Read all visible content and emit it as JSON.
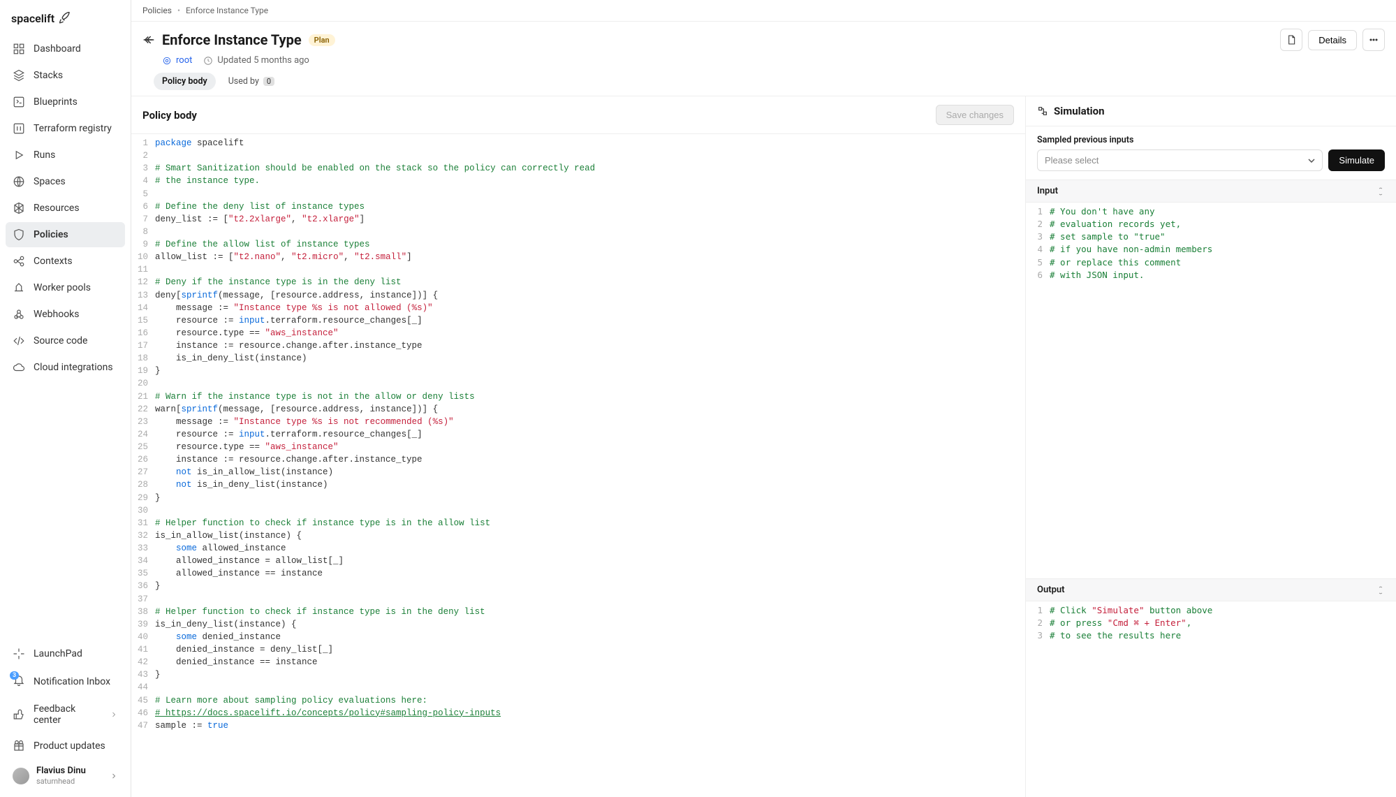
{
  "logo": "spacelift",
  "sidebar": {
    "items": [
      {
        "label": "Dashboard"
      },
      {
        "label": "Stacks"
      },
      {
        "label": "Blueprints"
      },
      {
        "label": "Terraform registry"
      },
      {
        "label": "Runs"
      },
      {
        "label": "Spaces"
      },
      {
        "label": "Resources"
      },
      {
        "label": "Policies"
      },
      {
        "label": "Contexts"
      },
      {
        "label": "Worker pools"
      },
      {
        "label": "Webhooks"
      },
      {
        "label": "Source code"
      },
      {
        "label": "Cloud integrations"
      }
    ],
    "bottom": [
      {
        "label": "LaunchPad"
      },
      {
        "label": "Notification Inbox",
        "badge": "3"
      },
      {
        "label": "Feedback center"
      },
      {
        "label": "Product updates"
      }
    ],
    "user": {
      "name": "Flavius Dinu",
      "org": "saturnhead"
    }
  },
  "breadcrumb": {
    "root": "Policies",
    "current": "Enforce Instance Type"
  },
  "header": {
    "title": "Enforce Instance Type",
    "badge": "Plan",
    "root_label": "root",
    "updated": "Updated 5 months ago",
    "details_label": "Details",
    "save_label": "Save changes"
  },
  "tabs": {
    "body": "Policy body",
    "usedby": "Used by",
    "usedby_count": "0"
  },
  "pane": {
    "body_title": "Policy body",
    "sim_title": "Simulation",
    "sampled_label": "Sampled previous inputs",
    "select_placeholder": "Please select",
    "simulate_label": "Simulate",
    "input_label": "Input",
    "output_label": "Output"
  },
  "code_lines": [
    [
      [
        "kw",
        "package"
      ],
      [
        "id",
        " spacelift"
      ]
    ],
    [],
    [
      [
        "cm",
        "# Smart Sanitization should be enabled on the stack so the policy can correctly read"
      ]
    ],
    [
      [
        "cm",
        "# the instance type."
      ]
    ],
    [],
    [
      [
        "cm",
        "# Define the deny list of instance types"
      ]
    ],
    [
      [
        "id",
        "deny_list := ["
      ],
      [
        "str",
        "\"t2.2xlarge\""
      ],
      [
        "id",
        ", "
      ],
      [
        "str",
        "\"t2.xlarge\""
      ],
      [
        "id",
        "]"
      ]
    ],
    [],
    [
      [
        "cm",
        "# Define the allow list of instance types"
      ]
    ],
    [
      [
        "id",
        "allow_list := ["
      ],
      [
        "str",
        "\"t2.nano\""
      ],
      [
        "id",
        ", "
      ],
      [
        "str",
        "\"t2.micro\""
      ],
      [
        "id",
        ", "
      ],
      [
        "str",
        "\"t2.small\""
      ],
      [
        "id",
        "]"
      ]
    ],
    [],
    [
      [
        "cm",
        "# Deny if the instance type is in the deny list"
      ]
    ],
    [
      [
        "id",
        "deny["
      ],
      [
        "kw",
        "sprintf"
      ],
      [
        "id",
        "(message, [resource.address, instance])] {"
      ]
    ],
    [
      [
        "id",
        "    message := "
      ],
      [
        "str",
        "\"Instance type %s is not allowed (%s)\""
      ]
    ],
    [
      [
        "id",
        "    resource := "
      ],
      [
        "kw",
        "input"
      ],
      [
        "id",
        ".terraform.resource_changes[_]"
      ]
    ],
    [
      [
        "id",
        "    resource.type == "
      ],
      [
        "str",
        "\"aws_instance\""
      ]
    ],
    [
      [
        "id",
        "    instance := resource.change.after.instance_type"
      ]
    ],
    [
      [
        "id",
        "    is_in_deny_list(instance)"
      ]
    ],
    [
      [
        "id",
        "}"
      ]
    ],
    [],
    [
      [
        "cm",
        "# Warn if the instance type is not in the allow or deny lists"
      ]
    ],
    [
      [
        "id",
        "warn["
      ],
      [
        "kw",
        "sprintf"
      ],
      [
        "id",
        "(message, [resource.address, instance])] {"
      ]
    ],
    [
      [
        "id",
        "    message := "
      ],
      [
        "str",
        "\"Instance type %s is not recommended (%s)\""
      ]
    ],
    [
      [
        "id",
        "    resource := "
      ],
      [
        "kw",
        "input"
      ],
      [
        "id",
        ".terraform.resource_changes[_]"
      ]
    ],
    [
      [
        "id",
        "    resource.type == "
      ],
      [
        "str",
        "\"aws_instance\""
      ]
    ],
    [
      [
        "id",
        "    instance := resource.change.after.instance_type"
      ]
    ],
    [
      [
        "id",
        "    "
      ],
      [
        "kw",
        "not"
      ],
      [
        "id",
        " is_in_allow_list(instance)"
      ]
    ],
    [
      [
        "id",
        "    "
      ],
      [
        "kw",
        "not"
      ],
      [
        "id",
        " is_in_deny_list(instance)"
      ]
    ],
    [
      [
        "id",
        "}"
      ]
    ],
    [],
    [
      [
        "cm",
        "# Helper function to check if instance type is in the allow list"
      ]
    ],
    [
      [
        "id",
        "is_in_allow_list(instance) {"
      ]
    ],
    [
      [
        "id",
        "    "
      ],
      [
        "kw",
        "some"
      ],
      [
        "id",
        " allowed_instance"
      ]
    ],
    [
      [
        "id",
        "    allowed_instance = allow_list[_]"
      ]
    ],
    [
      [
        "id",
        "    allowed_instance == instance"
      ]
    ],
    [
      [
        "id",
        "}"
      ]
    ],
    [],
    [
      [
        "cm",
        "# Helper function to check if instance type is in the deny list"
      ]
    ],
    [
      [
        "id",
        "is_in_deny_list(instance) {"
      ]
    ],
    [
      [
        "id",
        "    "
      ],
      [
        "kw",
        "some"
      ],
      [
        "id",
        " denied_instance"
      ]
    ],
    [
      [
        "id",
        "    denied_instance = deny_list[_]"
      ]
    ],
    [
      [
        "id",
        "    denied_instance == instance"
      ]
    ],
    [
      [
        "id",
        "}"
      ]
    ],
    [],
    [
      [
        "cm",
        "# Learn more about sampling policy evaluations here:"
      ]
    ],
    [
      [
        "cm link",
        "# https://docs.spacelift.io/concepts/policy#sampling-policy-inputs"
      ]
    ],
    [
      [
        "id",
        "sample := "
      ],
      [
        "kw",
        "true"
      ]
    ]
  ],
  "input_lines": [
    [
      [
        "cm",
        "# You don't have any"
      ]
    ],
    [
      [
        "cm",
        "# evaluation records yet,"
      ]
    ],
    [
      [
        "cm",
        "# set sample to \"true\""
      ]
    ],
    [
      [
        "cm",
        "# if you have non-admin members"
      ]
    ],
    [
      [
        "cm",
        "# or replace this comment"
      ]
    ],
    [
      [
        "cm",
        "# with JSON input."
      ]
    ]
  ],
  "output_lines": [
    [
      [
        "cm",
        "# Click "
      ],
      [
        "str",
        "\"Simulate\""
      ],
      [
        "cm",
        " button above"
      ]
    ],
    [
      [
        "cm",
        "# or press "
      ],
      [
        "str",
        "\"Cmd ⌘ + Enter\""
      ],
      [
        "cm",
        ","
      ]
    ],
    [
      [
        "cm",
        "# to see the results here"
      ]
    ]
  ]
}
